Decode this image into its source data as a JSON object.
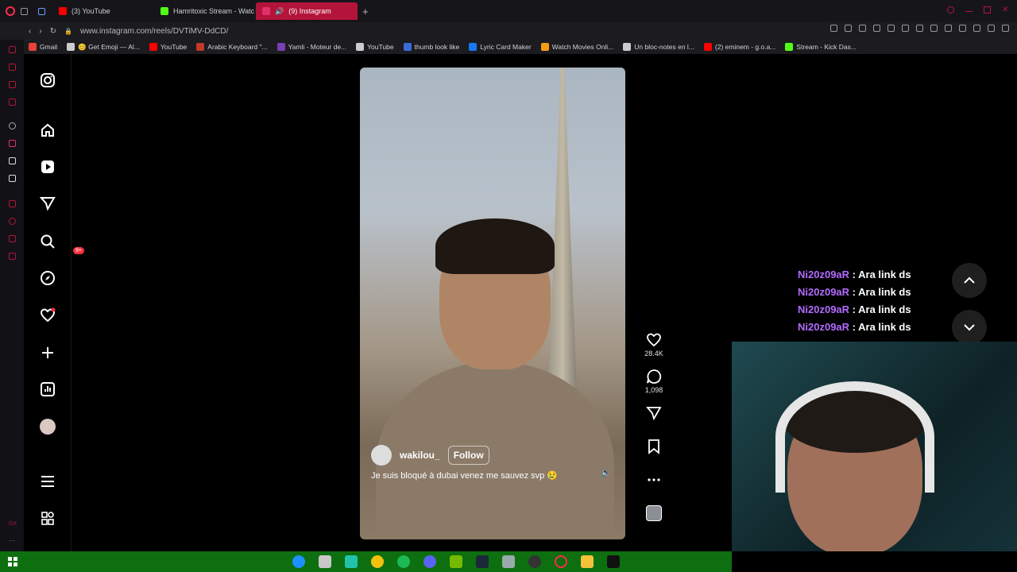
{
  "browser": {
    "tabs": [
      {
        "label": "(3) YouTube",
        "color": "#ff0000"
      },
      {
        "label": "Hamritoxic Stream - Watc",
        "color": "#53fc18"
      },
      {
        "label": "(9) Instagram",
        "color": "#e1306c"
      }
    ],
    "url": "www.instagram.com/reels/DVTiMV-DdCD/",
    "bookmarks": [
      "Gmail",
      "😊 Get Emoji — Al...",
      "YouTube",
      "Arabic Keyboard \"...",
      "Yamli - Moteur de...",
      "YouTube",
      "thumb look like",
      "Lyric Card Maker",
      "Watch Movies Onli...",
      "Un bloc-notes en l...",
      "(2) eminem - g.o.a...",
      "Stream - Kick Das..."
    ]
  },
  "ig_nav": {
    "badge": "9+"
  },
  "reel": {
    "username": "wakilou_",
    "follow_label": "Follow",
    "caption": "Je suis bloqué à dubai venez me sauvez svp 😢",
    "likes": "28.4K",
    "comments": "1,098"
  },
  "chat": {
    "lines": [
      {
        "user": "Ni20z09aR",
        "msg": " : Ara link ds"
      },
      {
        "user": "Ni20z09aR",
        "msg": " : Ara link ds"
      },
      {
        "user": "Ni20z09aR",
        "msg": " : Ara link ds"
      },
      {
        "user": "Ni20z09aR",
        "msg": " : Ara link ds"
      }
    ]
  },
  "colors": {
    "accent": "#b3143a",
    "chat_user": "#b36bff",
    "taskbar": "#0d6f10"
  }
}
